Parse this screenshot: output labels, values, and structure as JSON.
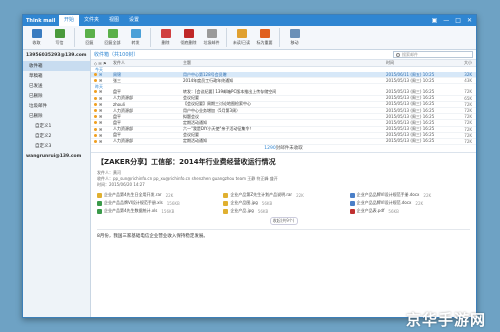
{
  "titlebar": {
    "app": "Think mail",
    "tabs": [
      "开始",
      "文件夹",
      "视图",
      "设置"
    ],
    "ctrls": [
      "▣",
      "—",
      "□",
      "✕"
    ]
  },
  "ribbon": {
    "buttons": [
      {
        "label": "收取",
        "color": "#3a7cc0"
      },
      {
        "label": "写信",
        "color": "#4a9a3c"
      },
      {
        "label": "回复",
        "color": "#5ab04a"
      },
      {
        "label": "回复全部",
        "color": "#5ab04a"
      },
      {
        "label": "转发",
        "color": "#4aa0d8"
      },
      {
        "label": "删除",
        "color": "#d04040"
      },
      {
        "label": "彻底删除",
        "color": "#c02828"
      },
      {
        "label": "垃圾邮件",
        "color": "#9a9a9a"
      },
      {
        "label": "未读/已读",
        "color": "#e0a030"
      },
      {
        "label": "标为重要",
        "color": "#e06020"
      },
      {
        "label": "移动",
        "color": "#6a90b8"
      }
    ]
  },
  "sidebar": {
    "account1": "13956035293@139.com",
    "items": [
      "收件箱",
      "草稿箱",
      "已发送",
      "已删除",
      "垃圾邮件",
      "已删除"
    ],
    "selected": 0,
    "subfolders": [
      "自定义1",
      "自定义2",
      "自定义3"
    ],
    "account2": "wangrunrui@139.com"
  },
  "list": {
    "title": "收件箱（共100封）",
    "search_placeholder": "搜索邮件",
    "columns": {
      "from": "发件人",
      "subject": "主题",
      "date": "时间",
      "size": "大小"
    },
    "groups": [
      "今天",
      "昨天"
    ],
    "rows_today": [
      {
        "from": "周锦",
        "subject": "用户中心第128号会员赠",
        "date": "2015/06/11 (周五) 10:25",
        "size": "32K",
        "selected": true
      },
      {
        "from": "张三",
        "subject": "2014年度员工行政年终通知",
        "date": "2015/05/13 (周三) 10:25",
        "size": "43K"
      }
    ],
    "rows_yesterday": [
      {
        "from": "盘平",
        "subject": "转发：[会议纪要] 139邮箱PC版本推出上传存储空间",
        "date": "2015/05/13 (周三) 16:25",
        "size": "72K"
      },
      {
        "from": "人力资源部",
        "subject": "会议纪要",
        "date": "2015/05/13 (周三) 16:25",
        "size": "65K"
      },
      {
        "from": "zhouli",
        "subject": "【会议纪要】周期三讨论地图检索中心",
        "date": "2015/05/13 (周三) 16:25",
        "size": "72K"
      },
      {
        "from": "人力资源部",
        "subject": "用户中心业务增加（5月第3周）",
        "date": "2015/05/13 (周三) 16:25",
        "size": "72K"
      },
      {
        "from": "盘平",
        "subject": "拟题会议",
        "date": "2015/05/13 (周三) 16:25",
        "size": "72K"
      },
      {
        "from": "盘平",
        "subject": "定期活动通知",
        "date": "2015/05/13 (周三) 16:25",
        "size": "72K"
      },
      {
        "from": "人力资源部",
        "subject": "六一\"我是DIY小天使\"亲子活动征集令！",
        "date": "2015/05/13 (周三) 16:25",
        "size": "72K"
      },
      {
        "from": "盘平",
        "subject": "会议纪要",
        "date": "2015/05/13 (周三) 16:25",
        "size": "72K"
      },
      {
        "from": "人力资源部",
        "subject": "定期活动通知",
        "date": "2015/05/13 (周三) 16:25",
        "size": "72K"
      }
    ],
    "more_count": "1290",
    "more_text": "封邮件未收取"
  },
  "preview": {
    "subject": "【ZAKER分享】工信部：2014年行业费经营收运行情况",
    "from": "发件人：黄河",
    "to": "收件人：pp_sun@richinfo.cn  pp_xu@richinfo.cn  shenzhen  guangzhou  team  王静  符正峰  盛开",
    "time": "时间：2015/06/20  14:27",
    "attachments": [
      {
        "name": "企业产品第4先生日全用开发.rar",
        "size": "22K",
        "color": "#e0b030"
      },
      {
        "name": "企业产品第Z先生计划产品说明.rar",
        "size": "22K",
        "color": "#e0b030"
      },
      {
        "name": "企业产品品牌VI设计规范手册.docx",
        "size": "22K",
        "color": "#4a7fc8"
      },
      {
        "name": "企业产品品牌VI设计规范手册.xls",
        "size": "156KB",
        "color": "#3a9a4a"
      },
      {
        "name": "企业产品图.jpg",
        "size": "56KB",
        "color": "#e0b030"
      },
      {
        "name": "企业产品品牌VI设计规范.docx",
        "size": "22K",
        "color": "#4a7fc8"
      },
      {
        "name": "企业产品第4先生数据统计.xls",
        "size": "156KB",
        "color": "#3a9a4a"
      },
      {
        "name": "企业产品.jpg",
        "size": "56KB",
        "color": "#e0b030"
      },
      {
        "name": "企业产品表.pdf",
        "size": "56KB",
        "color": "#c03030"
      }
    ],
    "toggle": "收起(共9个)",
    "body": "8月份，我国三家基础电信企业营业收入保持稳定发展。"
  },
  "watermark": "京华手游网"
}
